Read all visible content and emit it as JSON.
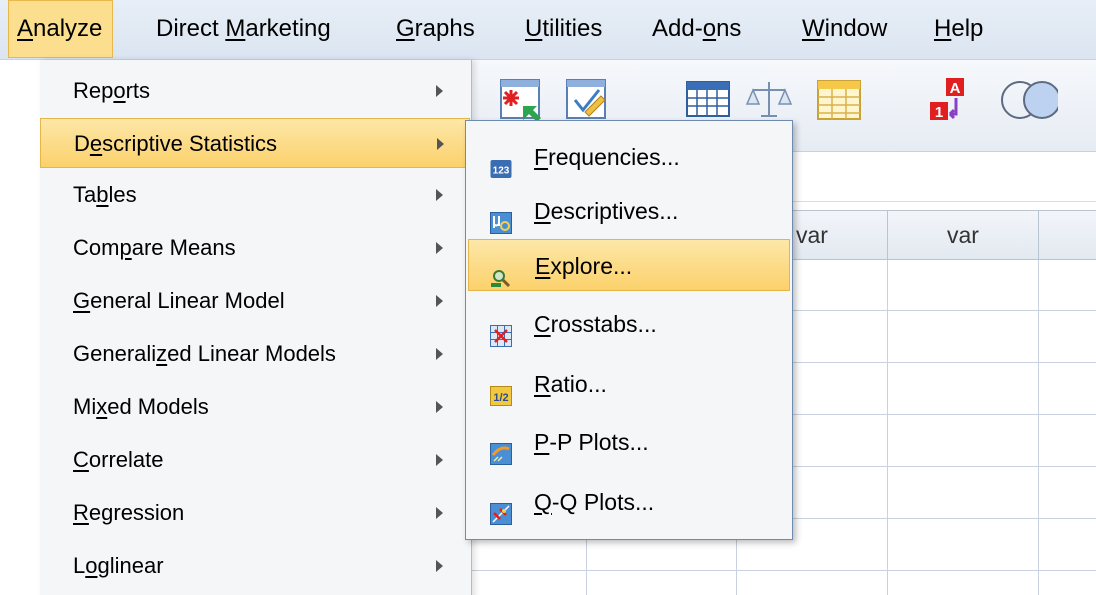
{
  "menubar": {
    "items": [
      {
        "pre": "",
        "key": "A",
        "post": "nalyze",
        "active": true
      },
      {
        "pre": "Direct ",
        "key": "M",
        "post": "arketing",
        "active": false
      },
      {
        "pre": "",
        "key": "G",
        "post": "raphs",
        "active": false
      },
      {
        "pre": "",
        "key": "U",
        "post": "tilities",
        "active": false
      },
      {
        "pre": "Add-",
        "key": "o",
        "post": "ns",
        "active": false
      },
      {
        "pre": "",
        "key": "W",
        "post": "indow",
        "active": false
      },
      {
        "pre": "",
        "key": "H",
        "post": "elp",
        "active": false
      }
    ]
  },
  "analyze_menu": {
    "items": [
      {
        "pre": "Rep",
        "key": "o",
        "post": "rts",
        "selected": false
      },
      {
        "pre": "D",
        "key": "e",
        "post": "scriptive Statistics",
        "selected": true
      },
      {
        "pre": "Ta",
        "key": "b",
        "post": "les",
        "selected": false
      },
      {
        "pre": "Com",
        "key": "p",
        "post": "are Means",
        "selected": false
      },
      {
        "pre": "",
        "key": "G",
        "post": "eneral Linear Model",
        "selected": false
      },
      {
        "pre": "Generali",
        "key": "z",
        "post": "ed Linear Models",
        "selected": false
      },
      {
        "pre": "Mi",
        "key": "x",
        "post": "ed Models",
        "selected": false
      },
      {
        "pre": "",
        "key": "C",
        "post": "orrelate",
        "selected": false
      },
      {
        "pre": "",
        "key": "R",
        "post": "egression",
        "selected": false
      },
      {
        "pre": "L",
        "key": "o",
        "post": "glinear",
        "selected": false
      }
    ]
  },
  "descriptive_submenu": {
    "items": [
      {
        "icon": "frequencies-icon",
        "pre": "",
        "key": "F",
        "post": "requencies...",
        "selected": false
      },
      {
        "icon": "descriptives-icon",
        "pre": "",
        "key": "D",
        "post": "escriptives...",
        "selected": false
      },
      {
        "icon": "explore-icon",
        "pre": "",
        "key": "E",
        "post": "xplore...",
        "selected": true
      },
      {
        "icon": "crosstabs-icon",
        "pre": "",
        "key": "C",
        "post": "rosstabs...",
        "selected": false
      },
      {
        "icon": "ratio-icon",
        "pre": "",
        "key": "R",
        "post": "atio...",
        "selected": false
      },
      {
        "icon": "pp-plots-icon",
        "pre": "",
        "key": "P",
        "post": "-P Plots...",
        "selected": false
      },
      {
        "icon": "qq-plots-icon",
        "pre": "",
        "key": "Q",
        "post": "-Q Plots...",
        "selected": false
      }
    ]
  },
  "icon_text": {
    "frequencies": "123",
    "ratio": "1/2",
    "toolbar_a": "A",
    "toolbar_1": "1"
  },
  "data_grid": {
    "column_headers": [
      "var",
      "var"
    ]
  },
  "colors": {
    "menubar_bg": "#dbe5f1",
    "highlight": "#fbd16b",
    "highlight_border": "#e5b64c",
    "menu_bg": "#f5f6f7"
  }
}
